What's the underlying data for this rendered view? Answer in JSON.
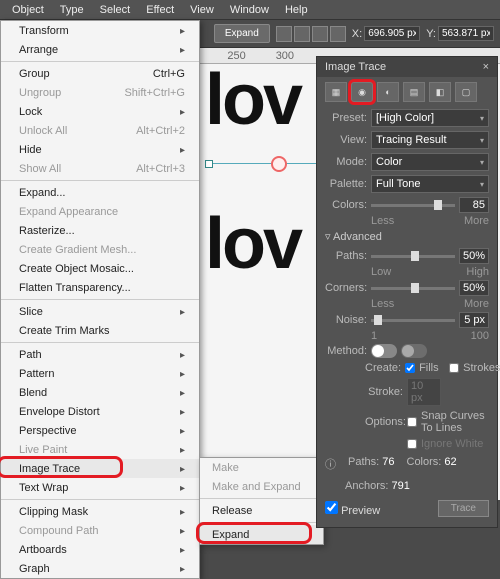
{
  "menubar": [
    "Object",
    "Type",
    "Select",
    "Effect",
    "View",
    "Window",
    "Help"
  ],
  "toolbar": {
    "expand": "Expand",
    "x_label": "X:",
    "x_val": "696.905 px",
    "y_label": "Y:",
    "y_val": "563.871 px"
  },
  "menu": {
    "transform": "Transform",
    "arrange": "Arrange",
    "group": "Group",
    "group_k": "Ctrl+G",
    "ungroup": "Ungroup",
    "ungroup_k": "Shift+Ctrl+G",
    "lock": "Lock",
    "unlock": "Unlock All",
    "unlock_k": "Alt+Ctrl+2",
    "hide": "Hide",
    "showall": "Show All",
    "showall_k": "Alt+Ctrl+3",
    "expand": "Expand...",
    "expand_app": "Expand Appearance",
    "rasterize": "Rasterize...",
    "gradmesh": "Create Gradient Mesh...",
    "objmosaic": "Create Object Mosaic...",
    "flatten": "Flatten Transparency...",
    "slice": "Slice",
    "trim": "Create Trim Marks",
    "path": "Path",
    "pattern": "Pattern",
    "blend": "Blend",
    "envelope": "Envelope Distort",
    "perspective": "Perspective",
    "livepaint": "Live Paint",
    "imgtrace": "Image Trace",
    "textwrap": "Text Wrap",
    "clipmask": "Clipping Mask",
    "compound": "Compound Path",
    "artboards": "Artboards",
    "graph": "Graph"
  },
  "submenu": {
    "make": "Make",
    "make_expand": "Make and Expand",
    "release": "Release",
    "expand": "Expand"
  },
  "panel": {
    "title": "Image Trace",
    "preset_lbl": "Preset:",
    "preset_val": "[High Color]",
    "view_lbl": "View:",
    "view_val": "Tracing Result",
    "mode_lbl": "Mode:",
    "mode_val": "Color",
    "palette_lbl": "Palette:",
    "palette_val": "Full Tone",
    "colors_lbl": "Colors:",
    "colors_val": "85",
    "less": "Less",
    "more": "More",
    "low": "Low",
    "high": "High",
    "advanced": "Advanced",
    "paths_lbl": "Paths:",
    "paths_val": "50%",
    "corners_lbl": "Corners:",
    "corners_val": "50%",
    "noise_lbl": "Noise:",
    "noise_val": "5 px",
    "noise_min": "1",
    "noise_max": "100",
    "method_lbl": "Method:",
    "create_lbl": "Create:",
    "fills": "Fills",
    "strokes": "Strokes",
    "stroke_lbl": "Stroke:",
    "stroke_val": "10 px",
    "options_lbl": "Options:",
    "snap": "Snap Curves To Lines",
    "ignore": "Ignore White",
    "info_paths_lbl": "Paths:",
    "info_paths": "76",
    "info_colors_lbl": "Colors:",
    "info_colors": "62",
    "info_anchors_lbl": "Anchors:",
    "info_anchors": "791",
    "preview": "Preview",
    "trace": "Trace"
  },
  "canvas": {
    "text": "lov"
  }
}
